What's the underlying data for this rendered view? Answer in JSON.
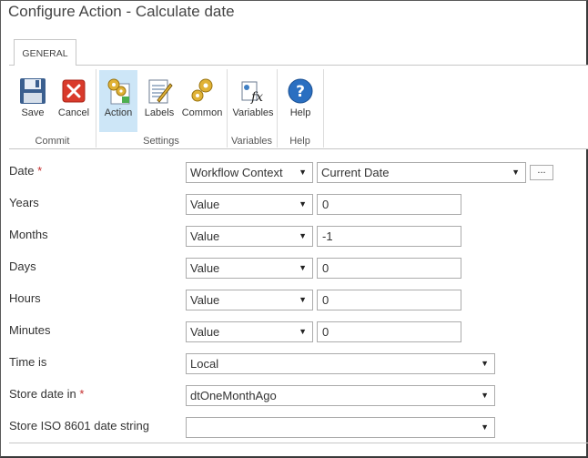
{
  "window": {
    "title": "Configure Action - Calculate date"
  },
  "ribbon": {
    "tab": "GENERAL",
    "buttons": {
      "save": {
        "label": "Save",
        "icon": "floppy-disk-icon"
      },
      "cancel": {
        "label": "Cancel",
        "icon": "close-icon"
      },
      "action": {
        "label": "Action",
        "icon": "action-gears-icon",
        "active": true
      },
      "labels": {
        "label": "Labels",
        "icon": "labels-icon"
      },
      "common": {
        "label": "Common",
        "icon": "gears-icon"
      },
      "variables": {
        "label": "Variables",
        "icon": "variables-fx-icon"
      },
      "help": {
        "label": "Help",
        "icon": "help-icon"
      }
    },
    "groups": {
      "commit": "Commit",
      "settings": "Settings",
      "variables": "Variables",
      "help": "Help"
    }
  },
  "form": {
    "date": {
      "label": "Date",
      "required_mark": "*",
      "source": "Workflow Context",
      "value": "Current Date",
      "ellipsis": "..."
    },
    "years": {
      "label": "Years",
      "type": "Value",
      "value": "0"
    },
    "months": {
      "label": "Months",
      "type": "Value",
      "value": "-1"
    },
    "days": {
      "label": "Days",
      "type": "Value",
      "value": "0"
    },
    "hours": {
      "label": "Hours",
      "type": "Value",
      "value": "0"
    },
    "minutes": {
      "label": "Minutes",
      "type": "Value",
      "value": "0"
    },
    "time_is": {
      "label": "Time is",
      "value": "Local"
    },
    "store_date_in": {
      "label": "Store date in",
      "required_mark": "*",
      "value": "dtOneMonthAgo"
    },
    "store_iso": {
      "label": "Store ISO 8601 date string",
      "value": ""
    }
  },
  "colors": {
    "active_button_bg": "#cde6f7",
    "required": "#c42c2c",
    "border": "#ababab"
  }
}
